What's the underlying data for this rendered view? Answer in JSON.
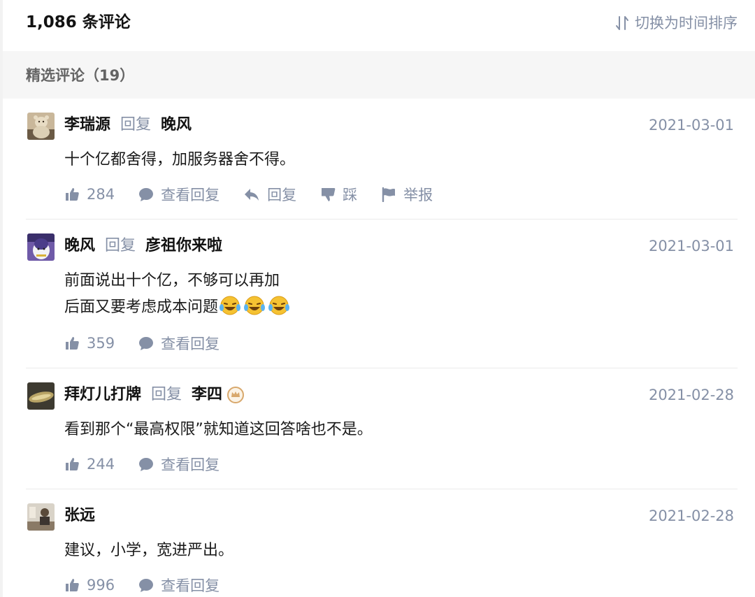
{
  "header": {
    "count_label": "1,086 条评论",
    "sort_label": "切换为时间排序"
  },
  "section": {
    "title": "精选评论（19）"
  },
  "comments": [
    {
      "author": "李瑞源",
      "reply_word": "回复",
      "reply_to": "晚风",
      "date": "2021-03-01",
      "lines": [
        "十个亿都舍得，加服务器舍不得。"
      ],
      "likes": "284",
      "view_replies": "查看回复",
      "reply": "回复",
      "dislike": "踩",
      "report": "举报"
    },
    {
      "author": "晚风",
      "reply_word": "回复",
      "reply_to": "彦祖你来啦",
      "date": "2021-03-01",
      "lines": [
        "前面说出十个亿，不够可以再加",
        "后面又要考虑成本问题"
      ],
      "likes": "359",
      "view_replies": "查看回复"
    },
    {
      "author": "拜灯儿打牌",
      "reply_word": "回复",
      "reply_to": "李四",
      "date": "2021-02-28",
      "lines": [
        "看到那个“最高权限”就知道这回答啥也不是。"
      ],
      "likes": "244",
      "view_replies": "查看回复"
    },
    {
      "author": "张远",
      "date": "2021-02-28",
      "lines": [
        "建议，小学，宽进严出。"
      ],
      "likes": "996",
      "view_replies": "查看回复"
    }
  ],
  "colors": {
    "muted": "#8590a6",
    "text": "#121212",
    "section_bg": "#f6f6f6",
    "divider": "#ebebeb",
    "badge": "#d8a86c"
  },
  "icons": [
    "sort-icon",
    "like-icon",
    "comment-icon",
    "reply-icon",
    "dislike-icon",
    "flag-icon",
    "laughing-emoji-icon",
    "author-badge-icon"
  ]
}
